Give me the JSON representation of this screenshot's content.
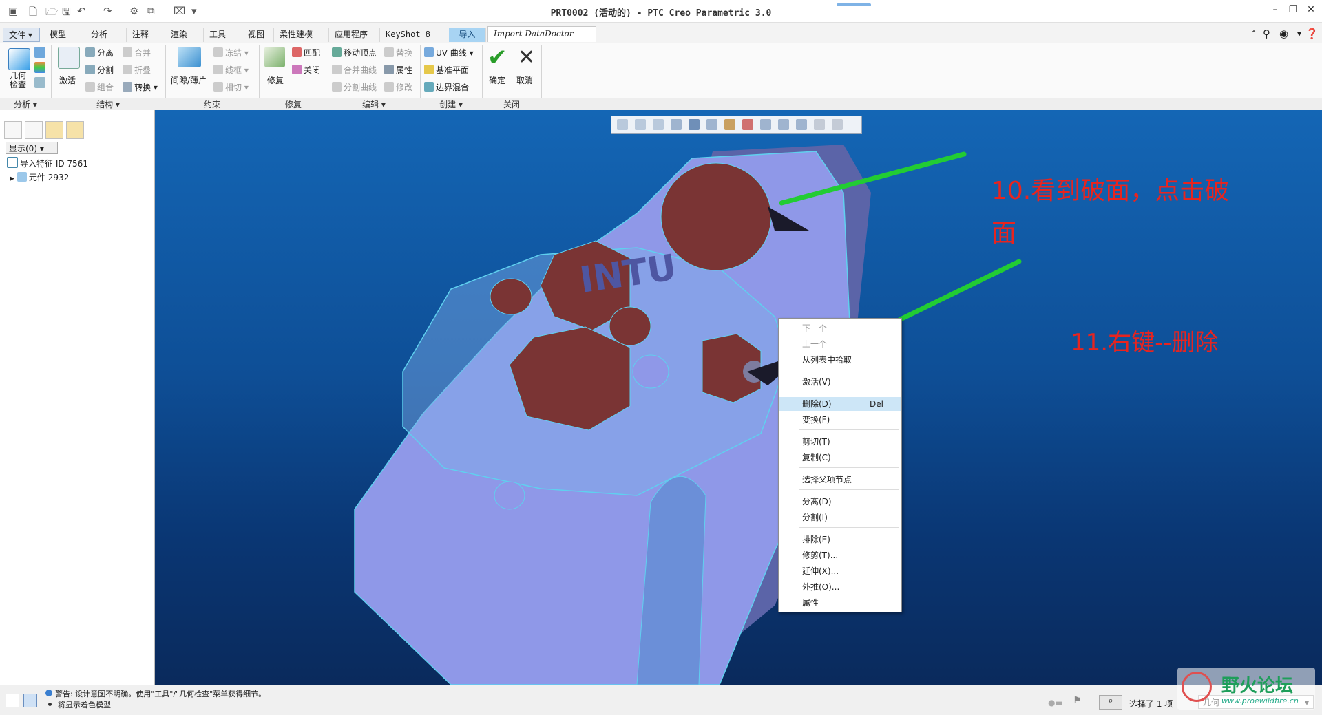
{
  "window": {
    "title": "PRT0002 (活动的) - PTC Creo Parametric 3.0",
    "controls": [
      "–",
      "❐",
      "✕"
    ]
  },
  "menu_tabs": [
    "文件",
    "模型",
    "分析",
    "注释",
    "渲染",
    "工具",
    "视图",
    "柔性建模",
    "应用程序",
    "KeyShot 8",
    "导入",
    "Import DataDoctor"
  ],
  "ribbon": {
    "analysis": {
      "geometry_check": "几何\n检查",
      "label": "分析"
    },
    "structure": {
      "activate": "激活",
      "separate": "分离",
      "split": "分割",
      "combine": "组合",
      "merge": "合并",
      "fold": "折叠",
      "convert": "转换",
      "label": "结构"
    },
    "constraint": {
      "gap": "间隙/薄片",
      "freeze": "冻结",
      "wireframe": "线框",
      "tangent": "相切",
      "label": "约束"
    },
    "repair": {
      "repair": "修复",
      "match": "匹配",
      "close": "关闭",
      "label": "修复"
    },
    "edit": {
      "move_vertex": "移动顶点",
      "merge_curve": "合并曲线",
      "split_curve": "分割曲线",
      "replace": "替换",
      "attribute": "属性",
      "modify": "修改",
      "label": "编辑"
    },
    "create": {
      "uv_curve": "UV 曲线",
      "datum_plane": "基准平面",
      "boundary_blend": "边界混合",
      "label": "创建"
    },
    "close": {
      "ok": "确定",
      "cancel": "取消",
      "label": "关闭"
    }
  },
  "left_panel": {
    "show_dropdown": "显示(0)",
    "tree": [
      {
        "label": "导入特征 ID 7561"
      },
      {
        "label": "元件 2932"
      }
    ]
  },
  "context_menu": {
    "items": [
      {
        "label": "下一个",
        "disabled": true
      },
      {
        "label": "上一个",
        "disabled": true
      },
      {
        "label": "从列表中拾取"
      },
      {
        "label": "激活(V)"
      },
      {
        "label": "删除(D)",
        "shortcut": "Del",
        "highlighted": true
      },
      {
        "label": "变换(F)"
      },
      {
        "label": "剪切(T)"
      },
      {
        "label": "复制(C)"
      },
      {
        "label": "选择父项节点"
      },
      {
        "label": "分离(D)"
      },
      {
        "label": "分割(I)"
      },
      {
        "label": "排除(E)"
      },
      {
        "label": "修剪(T)..."
      },
      {
        "label": "延伸(X)..."
      },
      {
        "label": "外推(O)..."
      },
      {
        "label": "属性"
      }
    ]
  },
  "annotations": {
    "step10_line1": "10.看到破面，点击破",
    "step10_line2": "面",
    "step11": "11.右键--删除",
    "color": "#e8241f",
    "arrow_color": "#22cc33"
  },
  "model": {
    "engraved_text": "INTU"
  },
  "status": {
    "warning": "警告: 设计意图不明确。使用\"工具\"/\"几何检查\"菜单获得细节。",
    "info": "将显示着色模型",
    "selection": "选择了 1 项",
    "filter": "几何"
  },
  "watermark": {
    "title": "野火论坛",
    "url": "www.proewildfire.cn"
  },
  "colors": {
    "viewport_top": "#1466b5",
    "viewport_bottom": "#0a2a5c",
    "model_body": "#8f98e8",
    "model_highlight": "#5fd0ef",
    "holes": "#7a3434",
    "menu_highlight": "#cde6f7"
  }
}
